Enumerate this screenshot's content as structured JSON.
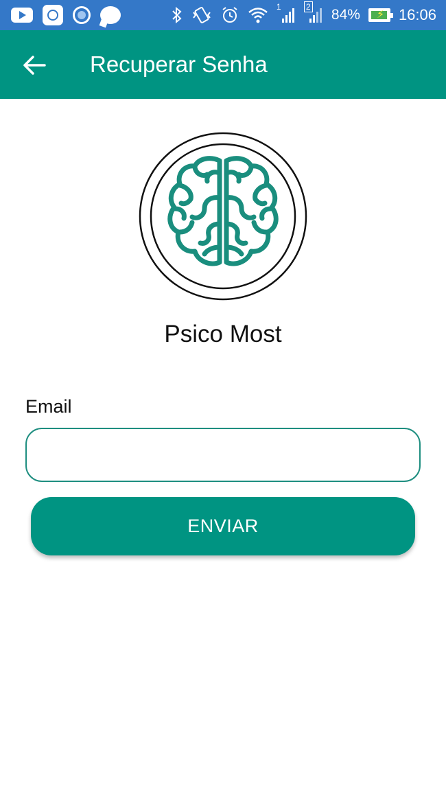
{
  "status_bar": {
    "battery": "84%",
    "time": "16:06",
    "sim1": "1",
    "sim2": "2",
    "icons": [
      "youtube-icon",
      "mi-icon",
      "circle-app-icon",
      "chat-bubble-icon",
      "bluetooth-icon",
      "vibrate-icon",
      "alarm-icon",
      "wifi-icon",
      "signal-icon",
      "signal-icon",
      "battery-icon"
    ]
  },
  "app_bar": {
    "title": "Recuperar Senha",
    "back_icon": "arrow-left-icon"
  },
  "logo": {
    "icon": "brain-icon",
    "accent": "#1a8e7e"
  },
  "brand_name": "Psico Most",
  "form": {
    "email_label": "Email",
    "email_value": "",
    "email_placeholder": "",
    "submit_label": "ENVIAR"
  },
  "colors": {
    "status_bar": "#3478c8",
    "primary": "#009482",
    "input_border": "#1e8e80"
  }
}
